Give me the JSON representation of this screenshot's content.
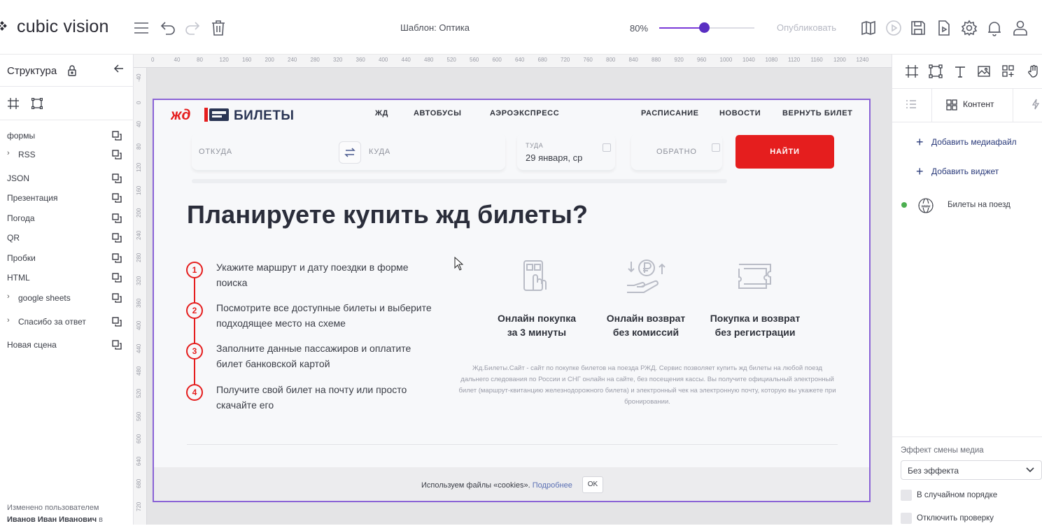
{
  "app": {
    "brand": "cubic vision",
    "template_label": "Шаблон: Оптика",
    "zoom_label": "80%",
    "zoom_level": 0.47,
    "publish_label": "Опубликовать"
  },
  "left_panel": {
    "title": "Структура",
    "items": [
      {
        "label": "формы",
        "expandable": false
      },
      {
        "label": "RSS",
        "expandable": true
      },
      {
        "label": "JSON",
        "expandable": false
      },
      {
        "label": "Презентация",
        "expandable": false
      },
      {
        "label": "Погода",
        "expandable": false
      },
      {
        "label": "QR",
        "expandable": false
      },
      {
        "label": "Пробки",
        "expandable": false
      },
      {
        "label": "HTML",
        "expandable": false
      },
      {
        "label": "google sheets",
        "expandable": true
      },
      {
        "label": "Спасибо за ответ",
        "expandable": true
      },
      {
        "label": "Новая сцена",
        "expandable": false
      }
    ],
    "changed_by_label": "Изменено пользователем",
    "changed_by_user": "Иванов Иван Иванович",
    "changed_by_suffix": "в"
  },
  "rulers": {
    "horizontal": [
      "0",
      "40",
      "80",
      "120",
      "160",
      "200",
      "240",
      "280",
      "320",
      "360",
      "400",
      "440",
      "480",
      "520",
      "560",
      "600",
      "640",
      "680",
      "720",
      "760",
      "800",
      "840",
      "880",
      "920",
      "960",
      "1000",
      "1040",
      "1080",
      "1120",
      "1160",
      "1200",
      "1240"
    ],
    "vertical": [
      "-40",
      "0",
      "40",
      "80",
      "120",
      "160",
      "200",
      "240",
      "280",
      "320",
      "360",
      "400",
      "440",
      "480",
      "520",
      "560",
      "600",
      "640",
      "680",
      "720"
    ]
  },
  "site": {
    "brand_jd": "жд",
    "brand_bilety": "БИЛЕТЫ",
    "nav_left": [
      "ЖД",
      "АВТОБУСЫ",
      "АЭРОЭКСПРЕСС"
    ],
    "nav_right": [
      "РАСПИСАНИЕ",
      "НОВОСТИ",
      "ВЕРНУТЬ БИЛЕТ"
    ],
    "search": {
      "from_placeholder": "ОТКУДА",
      "to_placeholder": "КУДА",
      "date_label": "ТУДА",
      "date_value": "29 января, ср",
      "return_placeholder": "ОБРАТНО",
      "find_button": "НАЙТИ"
    },
    "heading": "Планируете купить жд билеты?",
    "steps": [
      {
        "num": "1",
        "text": "Укажите маршрут и дату поездки в форме поиска"
      },
      {
        "num": "2",
        "text": "Посмотрите все доступные билеты и выберите подходящее место на схеме"
      },
      {
        "num": "3",
        "text": "Заполните данные пассажиров и оплатите билет банковской картой"
      },
      {
        "num": "4",
        "text": "Получите свой билет на почту или просто скачайте его"
      }
    ],
    "features": [
      {
        "line1": "Онлайн покупка",
        "line2": "за 3 минуты",
        "icon": "phone-touch-icon"
      },
      {
        "line1": "Онлайн возврат",
        "line2": "без комиссий",
        "icon": "ruble-refund-icon"
      },
      {
        "line1": "Покупка и возврат",
        "line2": "без регистрации",
        "icon": "ticket-icon"
      }
    ],
    "description": "Жд.Билеты.Сайт - сайт по покупке билетов на поезда РЖД. Сервис позволяет купить жд билеты на любой поезд дальнего следования по России и СНГ онлайн на сайте, без посещения кассы. Вы получите официальный электронный билет (маршрут-квитанцию железнодорожного билета) и электронный чек на электронную почту, которую вы укажете при бронировании.",
    "cookie": {
      "text": "Используем файлы «cookies».",
      "link": "Подробнее",
      "ok": "OK"
    }
  },
  "right_panel": {
    "tab_content": "Контент",
    "add_media": "Добавить медиафайл",
    "add_widget": "Добавить виджет",
    "widget_item": "Билеты на поезд",
    "effect_label": "Эффект смены медиа",
    "effect_value": "Без эффекта",
    "random_order": "В случайном порядке",
    "disable_check": "Отключить проверку"
  },
  "colors": {
    "accent": "#5a2fc2",
    "brand_red": "#e51e1e",
    "frame_border": "#8a63d6",
    "status_green": "#4caf50"
  }
}
